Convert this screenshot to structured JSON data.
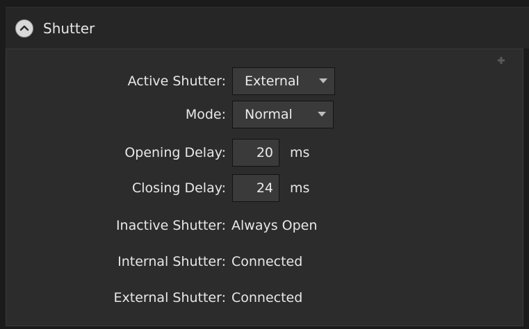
{
  "section": {
    "title": "Shutter"
  },
  "fields": {
    "active_shutter": {
      "label": "Active Shutter:",
      "value": "External"
    },
    "mode": {
      "label": "Mode:",
      "value": "Normal"
    },
    "opening_delay": {
      "label": "Opening Delay:",
      "value": "20",
      "unit": "ms"
    },
    "closing_delay": {
      "label": "Closing Delay:",
      "value": "24",
      "unit": "ms"
    },
    "inactive_shutter": {
      "label": "Inactive Shutter:",
      "value": "Always Open"
    },
    "internal_shutter": {
      "label": "Internal Shutter:",
      "value": "Connected"
    },
    "external_shutter": {
      "label": "External Shutter:",
      "value": "Connected"
    }
  },
  "icons": {
    "collapse": "chevron-up-icon",
    "expand_corner": "plus-icon",
    "dropdown": "triangle-down-icon"
  },
  "colors": {
    "panel_background": "#2c2c2c",
    "header_background": "#262626",
    "field_background": "#3a3a3a",
    "text": "#e8e8e8"
  }
}
